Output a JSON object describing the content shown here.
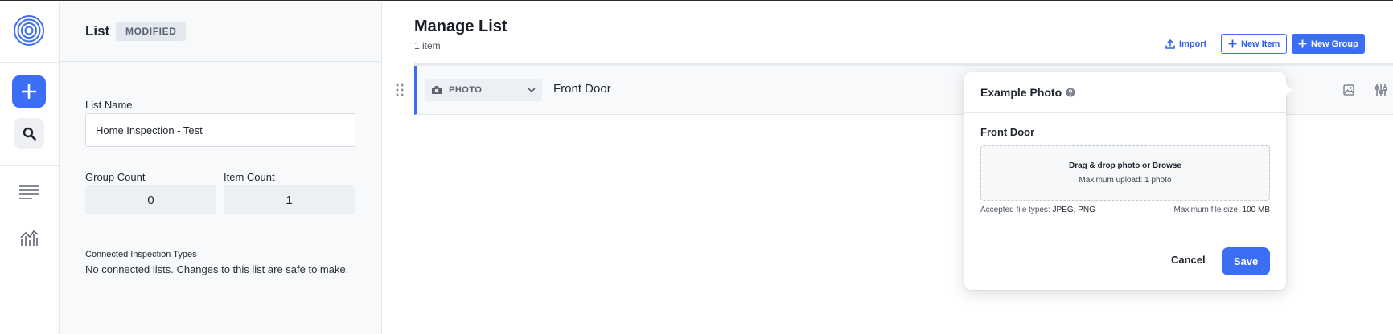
{
  "rail": {
    "icons": [
      "target-logo-icon",
      "plus-icon",
      "search-icon",
      "list-lines-icon",
      "analytics-chart-icon"
    ]
  },
  "panel": {
    "title": "List",
    "badge": "MODIFIED",
    "list_name_label": "List Name",
    "list_name_value": "Home Inspection - Test",
    "group_count_label": "Group Count",
    "group_count_value": "0",
    "item_count_label": "Item Count",
    "item_count_value": "1",
    "connected_label": "Connected Inspection Types",
    "connected_note": "No connected lists. Changes to this list are safe to make."
  },
  "main": {
    "title": "Manage List",
    "subtitle": "1 item",
    "import_label": "Import",
    "new_item_label": "New Item",
    "new_group_label": "New Group"
  },
  "row": {
    "type_label": "PHOTO",
    "item_name": "Front Door"
  },
  "popover": {
    "title": "Example Photo",
    "field_label": "Front Door",
    "drop_text": "Drag & drop photo or",
    "browse_label": "Browse",
    "max_upload_label": "Maximum upload:",
    "max_upload_value": "1 photo",
    "accepted_label": "Accepted file types:",
    "accepted_value": "JPEG, PNG",
    "max_size_label": "Maximum file size:",
    "max_size_value": "100 MB",
    "cancel_label": "Cancel",
    "save_label": "Save"
  },
  "colors": {
    "accent": "#3b6ef5",
    "panel_bg": "#f8f9fb",
    "badge_bg": "#e3e7ee"
  }
}
